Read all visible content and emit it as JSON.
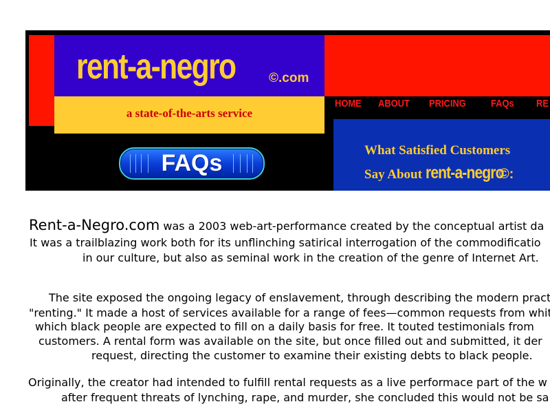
{
  "banner": {
    "logo_text": "rent-a-negro",
    "logo_suffix": "©.com",
    "tagline": "a state-of-the-arts service",
    "faq_button_label": "FAQs",
    "nav": [
      "HOME",
      "ABOUT",
      "PRICING",
      "FAQs",
      "RE"
    ],
    "testimonial_heading_line1": "What Satisfied Customers",
    "testimonial_heading_line2_prefix": "Say About",
    "testimonial_heading_brand": "rent-a-negro",
    "testimonial_heading_tail": "©:",
    "colors": {
      "red": "#ff1400",
      "logo_blue": "#3300cc",
      "gold": "#ffcc33",
      "panel_blue": "#0a2fb0",
      "nav_red": "#ff1a1a",
      "tagline_red": "#cc0000"
    }
  },
  "article": {
    "p1": {
      "lead_name": "Rent-a-Negro.com",
      "l1_rest": " was a 2003 web-art-performance created by the conceptual artist da",
      "l2": "It was a trailblazing work both for its unflinching satirical interrogation of the commodificatio",
      "l3": "in our culture, but also as seminal work in the creation of the genre of Internet Art."
    },
    "p2": [
      "The site exposed the ongoing legacy of enslavement, through describing the modern pract",
      "\"renting.\" It made a host of services available for a range of fees—common requests from whit",
      "which black people are expected to fill on a daily basis for free. It touted testimonials from",
      "customers. A rental form was available on the site, but once filled out and submitted, it der",
      "request, directing the customer to examine their existing debts to black people."
    ],
    "p3": [
      "Originally, the creator had intended to fulfill rental requests as a live performace part of the w",
      "after frequent threats of lynching, rape, and murder, she concluded this would not be sa"
    ]
  }
}
